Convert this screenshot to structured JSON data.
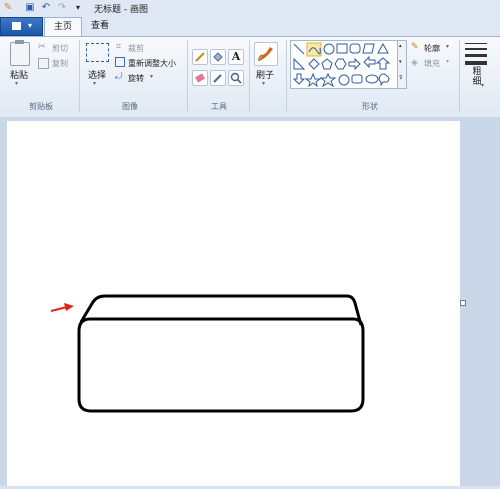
{
  "window": {
    "title": "无标题 - 画图"
  },
  "quick_access": {
    "customize_glyph": "▾"
  },
  "tabs": {
    "file_arrow": "▾",
    "home": "主页",
    "view": "查看"
  },
  "clipboard": {
    "paste": "粘贴",
    "cut": "剪切",
    "copy": "复制",
    "group": "剪贴板"
  },
  "image": {
    "select": "选择",
    "crop": "裁剪",
    "resize": "重新调整大小",
    "rotate": "旋转",
    "group": "图像"
  },
  "tools": {
    "group": "工具",
    "text_glyph": "A"
  },
  "brushes": {
    "label": "刷子"
  },
  "shapes": {
    "outline": "轮廓",
    "fill": "填充",
    "group": "形状"
  },
  "size": {
    "label": "粗细"
  },
  "colors": {
    "ribbon_bg": "#dfe8f3",
    "workspace_bg": "#cad7e8",
    "file_tab": "#2a63b4",
    "arrow": "#e0241d"
  },
  "icons": [
    "qat-app-icon",
    "qat-save-icon",
    "qat-undo-icon",
    "qat-redo-icon",
    "paste-icon",
    "cut-icon",
    "copy-icon",
    "select-icon",
    "crop-icon",
    "resize-icon",
    "rotate-icon",
    "pencil-icon",
    "fill-icon",
    "text-icon",
    "eraser-icon",
    "color-picker-icon",
    "magnifier-icon",
    "brush-icon",
    "outline-icon",
    "fill-shape-icon",
    "size-lines-icon"
  ]
}
